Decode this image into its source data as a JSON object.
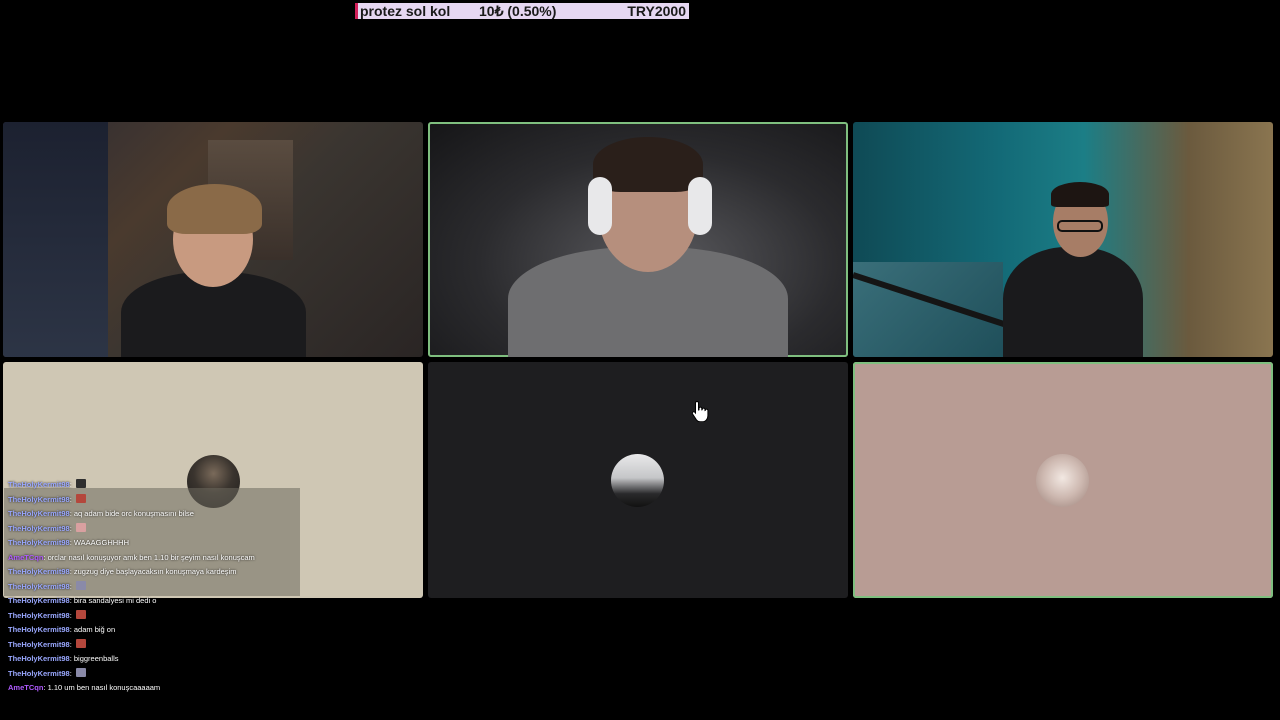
{
  "goal_bar": {
    "item_name": "protez sol kol",
    "amount": "10₺ (0.50%)",
    "target": "TRY2000",
    "background_color": "#e6d7f2",
    "marker_color": "#d21f5a"
  },
  "tiles": [
    {
      "type": "video",
      "speaking": false
    },
    {
      "type": "video",
      "speaking": true
    },
    {
      "type": "video",
      "speaking": false
    },
    {
      "type": "avatar",
      "speaking": false,
      "background": "#cfc7b4"
    },
    {
      "type": "avatar",
      "speaking": false,
      "background": "#1e1e20"
    },
    {
      "type": "avatar",
      "speaking": true,
      "background": "#b89c94"
    }
  ],
  "chat": {
    "separator": ":",
    "messages": [
      {
        "user": "TheHolyKermit98",
        "text": "",
        "emote": "dark-emote",
        "emote_color": "#2f2f2f",
        "faded": false
      },
      {
        "user": "TheHolyKermit98",
        "text": "",
        "emote": "red-emote",
        "emote_color": "#b4473c",
        "faded": false
      },
      {
        "user": "TheHolyKermit98",
        "text": "aq adam bide orc konuşmasını bilse",
        "emote": "",
        "faded": false
      },
      {
        "user": "TheHolyKermit98",
        "text": "",
        "emote": "pink-emote",
        "emote_color": "#d9a0a0",
        "faded": false
      },
      {
        "user": "TheHolyKermit98",
        "text": "WAAAGGHHHH",
        "emote": "",
        "faded": false
      },
      {
        "user": "AmeTCqn",
        "text": "orclar nasıl konuşuyor amk ben 1.10 bir şeyim nasıl konuşcam",
        "emote": "",
        "faded": false,
        "purple": true
      },
      {
        "user": "TheHolyKermit98",
        "text": "zugzug diye başlayacaksın konuşmaya kardeşim",
        "emote": "",
        "faded": false
      },
      {
        "user": "TheHolyKermit98",
        "text": "",
        "emote": "figure-emote",
        "emote_color": "#8a8aa8",
        "faded": false
      },
      {
        "user": "TheHolyKermit98",
        "text": "bira sandalyesi mi dedi o",
        "emote": "",
        "faded": false
      },
      {
        "user": "TheHolyKermit98",
        "text": "",
        "emote": "red-emote",
        "emote_color": "#b4473c",
        "faded": false
      },
      {
        "user": "TheHolyKermit98",
        "text": "adam biğ on",
        "emote": "",
        "faded": false
      },
      {
        "user": "TheHolyKermit98",
        "text": "",
        "emote": "red-emote",
        "emote_color": "#b4473c",
        "faded": false
      },
      {
        "user": "TheHolyKermit98",
        "text": "biggreenballs",
        "emote": "",
        "faded": false
      },
      {
        "user": "TheHolyKermit98",
        "text": "",
        "emote": "figure-emote",
        "emote_color": "#8a8aa8",
        "faded": false
      },
      {
        "user": "AmeTCqn",
        "text": "1.10 um ben nasıl konuşcaaaaam",
        "emote": "",
        "faded": false,
        "purple": true
      }
    ]
  }
}
